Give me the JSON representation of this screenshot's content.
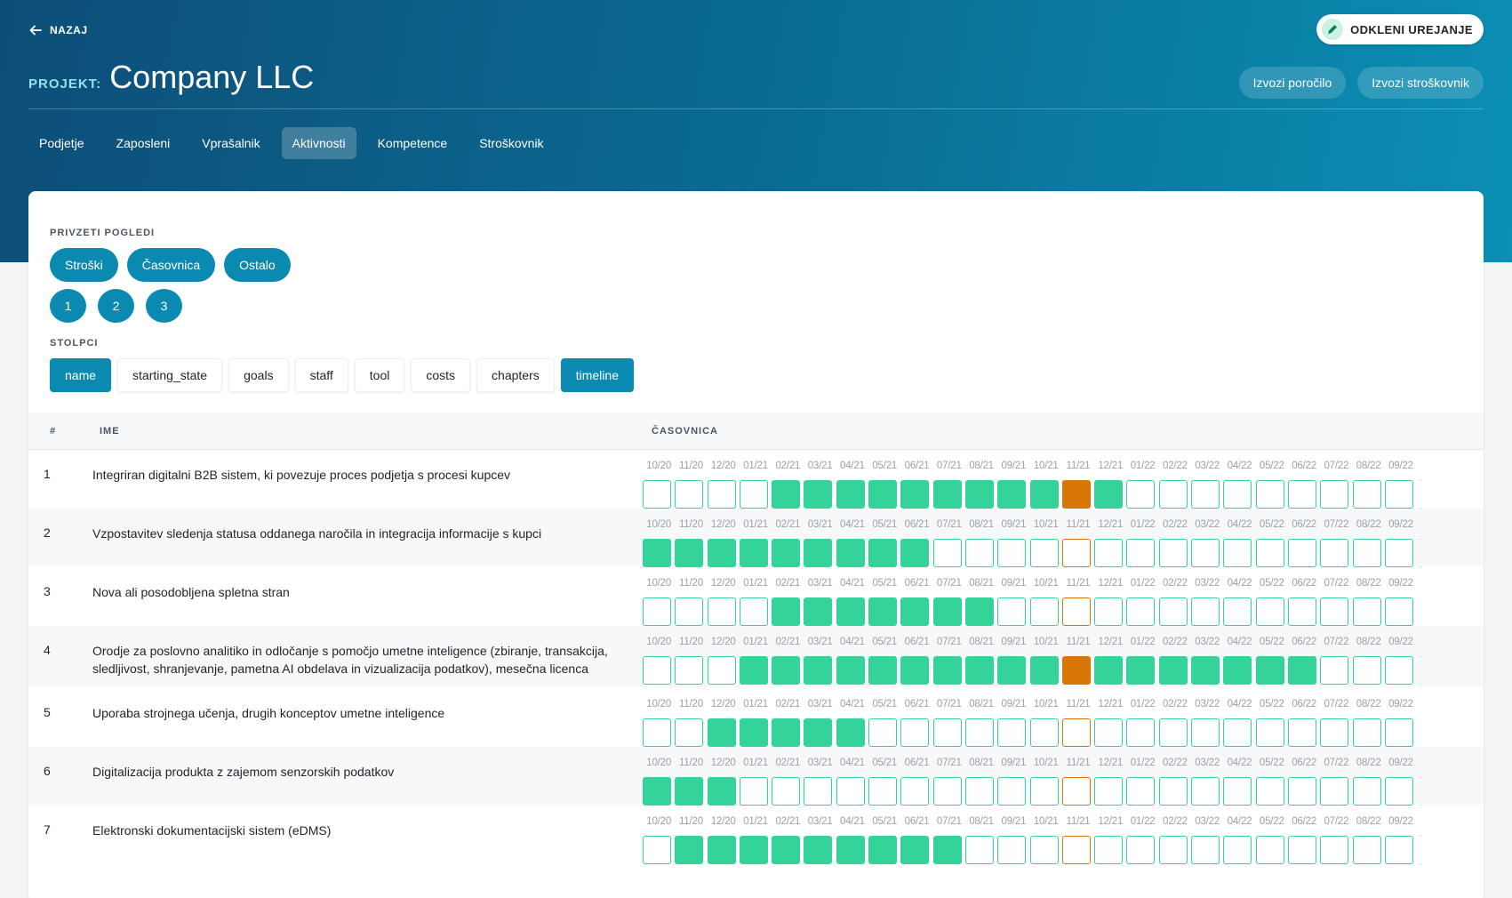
{
  "header": {
    "back_label": "NAZAJ",
    "title_prefix": "PROJEKT:",
    "title": "Company LLC",
    "unlock_label": "ODKLENI UREJANJE",
    "export_report": "Izvozi poročilo",
    "export_costs": "Izvozi stroškovnik"
  },
  "tabs": [
    {
      "label": "Podjetje",
      "active": false
    },
    {
      "label": "Zaposleni",
      "active": false
    },
    {
      "label": "Vprašalnik",
      "active": false
    },
    {
      "label": "Aktivnosti",
      "active": true
    },
    {
      "label": "Kompetence",
      "active": false
    },
    {
      "label": "Stroškovnik",
      "active": false
    }
  ],
  "views": {
    "label": "PRIVZETI POGLEDI",
    "named": [
      "Stroški",
      "Časovnica",
      "Ostalo"
    ],
    "numbered": [
      "1",
      "2",
      "3"
    ]
  },
  "columns": {
    "label": "STOLPCI",
    "items": [
      {
        "label": "name",
        "on": true
      },
      {
        "label": "starting_state",
        "on": false
      },
      {
        "label": "goals",
        "on": false
      },
      {
        "label": "staff",
        "on": false
      },
      {
        "label": "tool",
        "on": false
      },
      {
        "label": "costs",
        "on": false
      },
      {
        "label": "chapters",
        "on": false
      },
      {
        "label": "timeline",
        "on": true
      }
    ]
  },
  "table": {
    "headers": {
      "num": "#",
      "name": "IME",
      "timeline": "ČASOVNICA"
    },
    "months": [
      "10/20",
      "11/20",
      "12/20",
      "01/21",
      "02/21",
      "03/21",
      "04/21",
      "05/21",
      "06/21",
      "07/21",
      "08/21",
      "09/21",
      "10/21",
      "11/21",
      "12/21",
      "01/22",
      "02/22",
      "03/22",
      "04/22",
      "05/22",
      "06/22",
      "07/22",
      "08/22",
      "09/22"
    ],
    "current_month_index": 13,
    "colors": {
      "active": "#34d399",
      "current": "#d97706"
    },
    "rows": [
      {
        "num": "1",
        "name": "Integriran digitalni B2B sistem, ki povezuje proces podjetja s procesi kupcev",
        "active": [
          0,
          0,
          0,
          0,
          1,
          1,
          1,
          1,
          1,
          1,
          1,
          1,
          1,
          1,
          1,
          0,
          0,
          0,
          0,
          0,
          0,
          0,
          0,
          0
        ]
      },
      {
        "num": "2",
        "name": "Vzpostavitev sledenja statusa oddanega naročila in integracija informacije s kupci",
        "active": [
          1,
          1,
          1,
          1,
          1,
          1,
          1,
          1,
          1,
          0,
          0,
          0,
          0,
          0,
          0,
          0,
          0,
          0,
          0,
          0,
          0,
          0,
          0,
          0
        ]
      },
      {
        "num": "3",
        "name": "Nova ali posodobljena spletna stran",
        "active": [
          0,
          0,
          0,
          0,
          1,
          1,
          1,
          1,
          1,
          1,
          1,
          0,
          0,
          0,
          0,
          0,
          0,
          0,
          0,
          0,
          0,
          0,
          0,
          0
        ]
      },
      {
        "num": "4",
        "name": "Orodje za poslovno analitiko in odločanje s pomočjo umetne inteligence (zbiranje, transakcija, sledljivost, shranjevanje, pametna AI obdelava in vizualizacija podatkov), mesečna licenca",
        "active": [
          0,
          0,
          0,
          1,
          1,
          1,
          1,
          1,
          1,
          1,
          1,
          1,
          1,
          1,
          1,
          1,
          1,
          1,
          1,
          1,
          1,
          0,
          0,
          0
        ]
      },
      {
        "num": "5",
        "name": "Uporaba strojnega učenja, drugih konceptov umetne inteligence",
        "active": [
          0,
          0,
          1,
          1,
          1,
          1,
          1,
          0,
          0,
          0,
          0,
          0,
          0,
          0,
          0,
          0,
          0,
          0,
          0,
          0,
          0,
          0,
          0,
          0
        ]
      },
      {
        "num": "6",
        "name": "Digitalizacija produkta z zajemom senzorskih podatkov",
        "active": [
          1,
          1,
          1,
          0,
          0,
          0,
          0,
          0,
          0,
          0,
          0,
          0,
          0,
          0,
          0,
          0,
          0,
          0,
          0,
          0,
          0,
          0,
          0,
          0
        ]
      },
      {
        "num": "7",
        "name": "Elektronski dokumentacijski sistem (eDMS)",
        "active": [
          0,
          1,
          1,
          1,
          1,
          1,
          1,
          1,
          1,
          1,
          0,
          0,
          0,
          0,
          0,
          0,
          0,
          0,
          0,
          0,
          0,
          0,
          0,
          0
        ]
      }
    ]
  }
}
